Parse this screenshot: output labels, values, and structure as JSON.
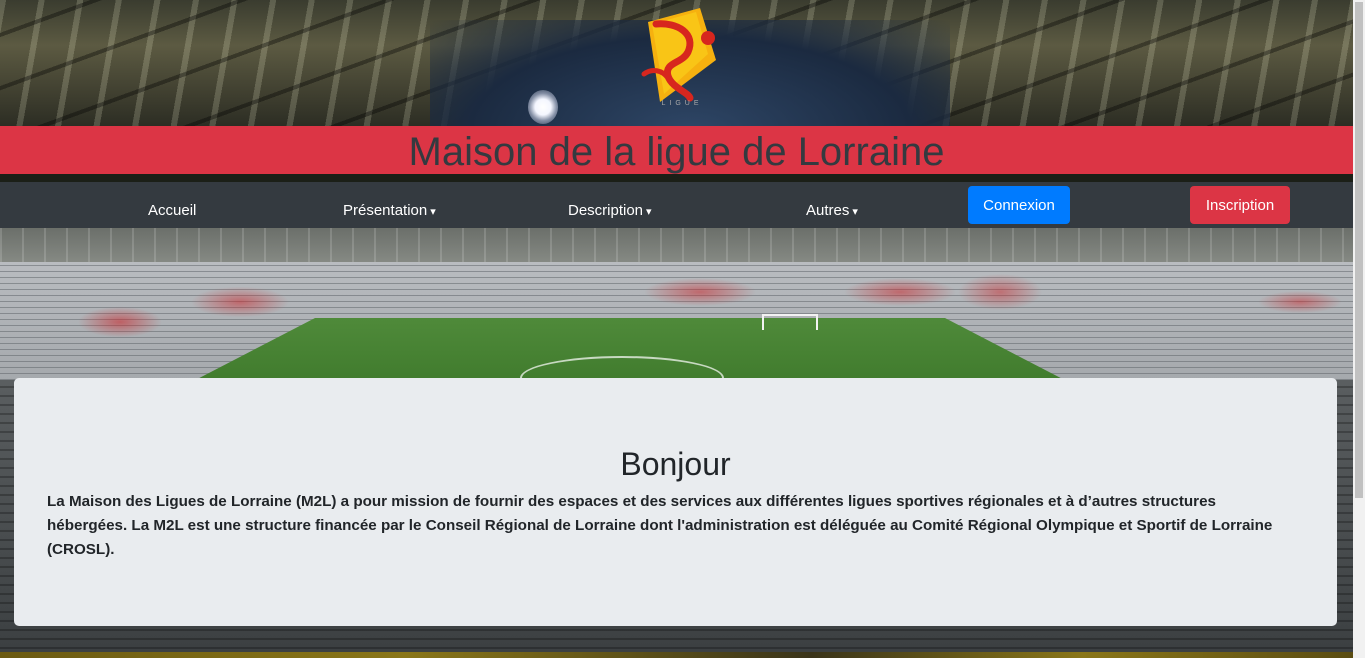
{
  "header": {
    "logo_caption": "LIGUE",
    "title": "Maison de la ligue de Lorraine"
  },
  "nav": {
    "items": [
      {
        "label": "Accueil",
        "dropdown": false
      },
      {
        "label": "Présentation",
        "dropdown": true
      },
      {
        "label": "Description",
        "dropdown": true
      },
      {
        "label": "Autres",
        "dropdown": true
      }
    ],
    "caret": "▾",
    "login_label": "Connexion",
    "signup_label": "Inscription"
  },
  "main": {
    "heading": "Bonjour",
    "text": "La Maison des Ligues de Lorraine (M2L) a pour mission de fournir des espaces et des services aux différentes ligues sportives régionales et à d’autres structures hébergées. La M2L est une structure financée par le Conseil Régional de Lorraine dont l'administration est déléguée au Comité Régional Olympique et Sportif de Lorraine (CROSL)."
  },
  "colors": {
    "title_band": "#dc3545",
    "navbar": "#343a40",
    "primary": "#007bff",
    "danger": "#dc3545",
    "card": "#e9ecef"
  }
}
